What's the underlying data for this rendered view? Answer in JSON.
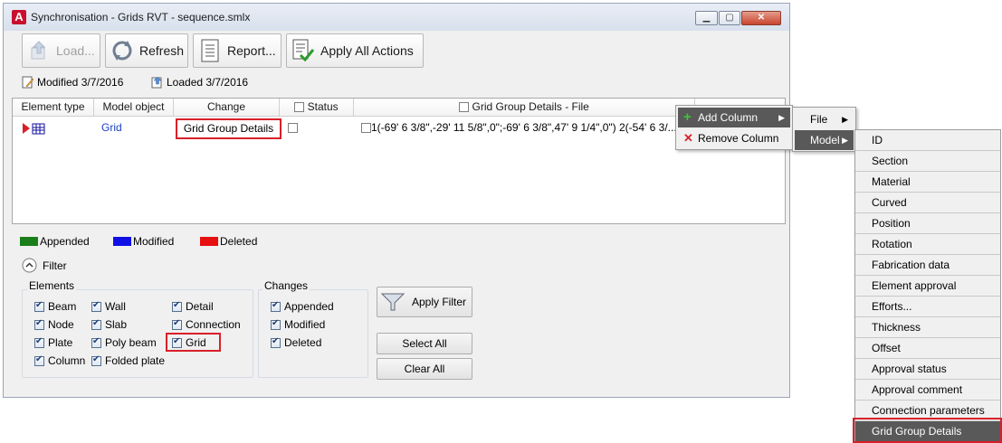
{
  "window": {
    "title": "Synchronisation - Grids RVT - sequence.smlx",
    "app_logo": "A"
  },
  "toolbar": {
    "load_label": "Load...",
    "refresh_label": "Refresh",
    "report_label": "Report...",
    "apply_all_label": "Apply All Actions"
  },
  "info": {
    "modified": "Modified 3/7/2016",
    "loaded": "Loaded 3/7/2016"
  },
  "table": {
    "headers": [
      "Element type",
      "Model object",
      "Change",
      "Status",
      "Grid Group Details - File"
    ],
    "rows": [
      {
        "model_object": "Grid",
        "change": "Grid Group Details",
        "file_value": "1(-69' 6 3/8\",-29' 11 5/8\",0\";-69' 6 3/8\",47' 9 1/4\",0\") 2(-54' 6 3/..."
      }
    ]
  },
  "legend": [
    {
      "label": "Appended",
      "color": "#1a7f1a"
    },
    {
      "label": "Modified",
      "color": "#1010e6"
    },
    {
      "label": "Deleted",
      "color": "#e61010"
    }
  ],
  "filter": {
    "label": "Filter",
    "elements_title": "Elements",
    "elements": [
      "Beam",
      "Node",
      "Plate",
      "Column",
      "Wall",
      "Slab",
      "Poly beam",
      "Folded plate",
      "Detail",
      "Connection",
      "Grid"
    ],
    "changes_title": "Changes",
    "changes": [
      "Appended",
      "Modified",
      "Deleted"
    ],
    "apply_filter": "Apply Filter",
    "select_all": "Select All",
    "clear_all": "Clear All"
  },
  "context_menu": {
    "add_column": "Add Column",
    "remove_column": "Remove Column",
    "file": "File",
    "model": "Model",
    "model_items": [
      "ID",
      "Section",
      "Material",
      "Curved",
      "Position",
      "Rotation",
      "Fabrication data",
      "Element approval",
      "Efforts...",
      "Thickness",
      "Offset",
      "Approval status",
      "Approval comment",
      "Connection parameters",
      "Grid Group Details"
    ]
  },
  "colors": {
    "highlight_red": "#d8202a",
    "link_blue": "#1a3fc4",
    "menu_selected": "#595959"
  }
}
